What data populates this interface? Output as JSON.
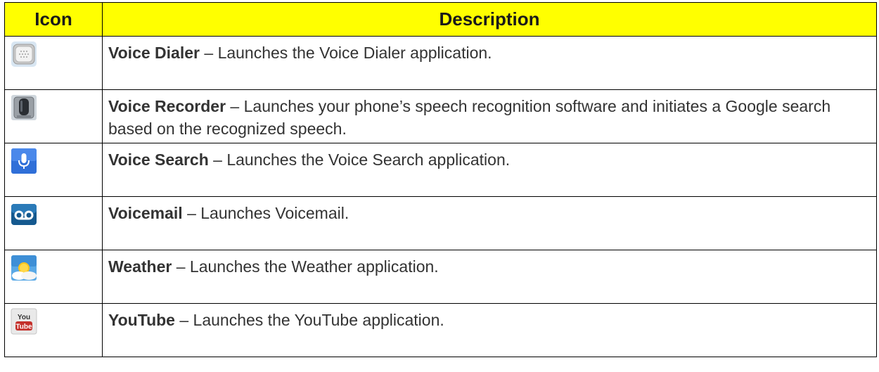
{
  "table": {
    "header": {
      "icon": "Icon",
      "description": "Description"
    },
    "rows": [
      {
        "icon": "voice-dialer-icon",
        "name": "Voice Dialer",
        "sep": " – ",
        "text": "Launches the Voice Dialer application."
      },
      {
        "icon": "voice-recorder-icon",
        "name": "Voice Recorder",
        "sep": " – ",
        "text": "Launches your phone’s speech recognition software and initiates a Google search based on the recognized speech."
      },
      {
        "icon": "voice-search-icon",
        "name": "Voice Search",
        "sep": " – ",
        "text": "Launches the Voice Search application."
      },
      {
        "icon": "voicemail-icon",
        "name": "Voicemail",
        "sep": " – ",
        "text": "Launches Voicemail."
      },
      {
        "icon": "weather-icon",
        "name": "Weather",
        "sep": " – ",
        "text": "Launches the Weather application."
      },
      {
        "icon": "youtube-icon",
        "name": "YouTube",
        "sep": " – ",
        "text": "Launches the YouTube application.",
        "icon_text_top": "You",
        "icon_text_bottom": "Tube"
      }
    ]
  },
  "colors": {
    "header_bg": "#ffff00",
    "border": "#000000",
    "text": "#333333"
  }
}
